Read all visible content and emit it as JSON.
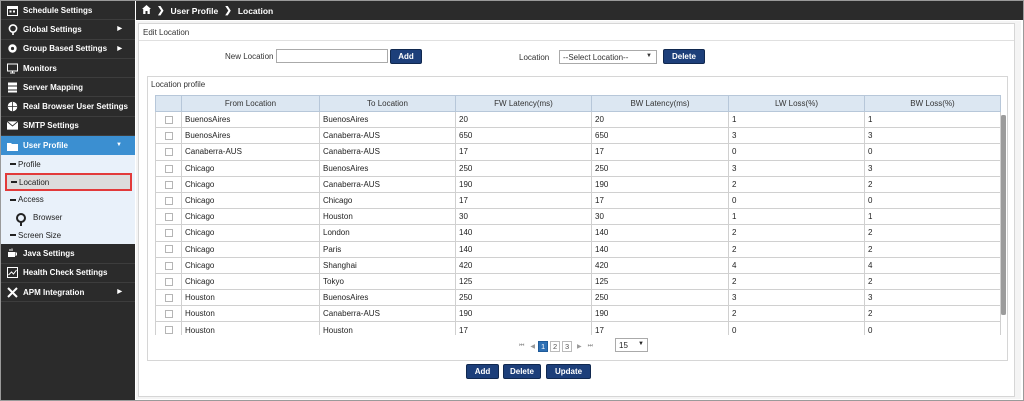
{
  "sidebar": {
    "items_top": [
      {
        "label": "Schedule Settings",
        "icon": "calendar-icon"
      },
      {
        "label": "Global Settings",
        "icon": "location-pin-icon",
        "arrow": true
      },
      {
        "label": "Group Based Settings",
        "icon": "gear-icon",
        "arrow": true
      },
      {
        "label": "Monitors",
        "icon": "monitor-icon"
      },
      {
        "label": "Server Mapping",
        "icon": "server-icon"
      },
      {
        "label": "Real Browser User Settings",
        "icon": "globe-icon"
      },
      {
        "label": "SMTP Settings",
        "icon": "envelope-icon"
      }
    ],
    "active": {
      "label": "User Profile",
      "icon": "folder-icon"
    },
    "subitems": [
      "Profile",
      "Location",
      "Access",
      "Browser",
      "Screen Size"
    ],
    "items_bottom": [
      {
        "label": "Java Settings",
        "icon": "coffee-cup-icon"
      },
      {
        "label": "Health Check Settings",
        "icon": "chart-icon"
      },
      {
        "label": "APM Integration",
        "icon": "tools-icon",
        "arrow": true
      }
    ]
  },
  "breadcrumb": {
    "home_icon": "home-icon",
    "level1": "User Profile",
    "level2": "Location"
  },
  "panel": {
    "title": "Edit Location",
    "new_location_label": "New Location",
    "new_location_value": "",
    "add_label": "Add",
    "location_label": "Location",
    "location_select": "--Select Location--",
    "delete_label": "Delete"
  },
  "profile": {
    "title": "Location profile",
    "columns": [
      "From Location",
      "To Location",
      "FW Latency(ms)",
      "BW Latency(ms)",
      "LW Loss(%)",
      "BW Loss(%)"
    ],
    "rows": [
      [
        "BuenosAires",
        "BuenosAires",
        "20",
        "20",
        "1",
        "1"
      ],
      [
        "BuenosAires",
        "Canaberra-AUS",
        "650",
        "650",
        "3",
        "3"
      ],
      [
        "Canaberra-AUS",
        "Canaberra-AUS",
        "17",
        "17",
        "0",
        "0"
      ],
      [
        "Chicago",
        "BuenosAires",
        "250",
        "250",
        "3",
        "3"
      ],
      [
        "Chicago",
        "Canaberra-AUS",
        "190",
        "190",
        "2",
        "2"
      ],
      [
        "Chicago",
        "Chicago",
        "17",
        "17",
        "0",
        "0"
      ],
      [
        "Chicago",
        "Houston",
        "30",
        "30",
        "1",
        "1"
      ],
      [
        "Chicago",
        "London",
        "140",
        "140",
        "2",
        "2"
      ],
      [
        "Chicago",
        "Paris",
        "140",
        "140",
        "2",
        "2"
      ],
      [
        "Chicago",
        "Shanghai",
        "420",
        "420",
        "4",
        "4"
      ],
      [
        "Chicago",
        "Tokyo",
        "125",
        "125",
        "2",
        "2"
      ],
      [
        "Houston",
        "BuenosAires",
        "250",
        "250",
        "3",
        "3"
      ],
      [
        "Houston",
        "Canaberra-AUS",
        "190",
        "190",
        "2",
        "2"
      ],
      [
        "Houston",
        "Houston",
        "17",
        "17",
        "0",
        "0"
      ]
    ],
    "pager": {
      "pages": [
        "1",
        "2",
        "3"
      ],
      "current": "1",
      "page_size": "15"
    }
  },
  "actions": {
    "add": "Add",
    "delete": "Delete",
    "update": "Update"
  },
  "colors": {
    "sidebar_bg": "#2b2b2b",
    "active_item": "#3b8fd1",
    "button": "#1d3f7a",
    "selected_outline": "#e23a3a",
    "grid_header": "#dce7f2"
  }
}
